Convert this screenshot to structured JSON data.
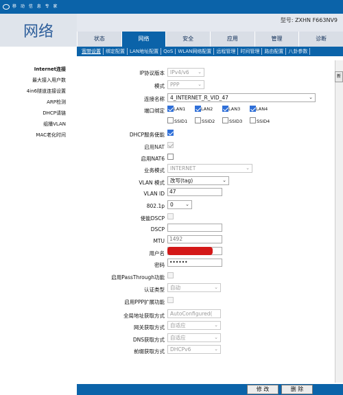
{
  "brand": {
    "slogan": "移 动 信 息 专 家"
  },
  "header": {
    "model_label": "型号:",
    "model_value": "ZXHN F663NV9",
    "section_title": "网络"
  },
  "tabs": [
    "状态",
    "网络",
    "安全",
    "应用",
    "管理",
    "诊断"
  ],
  "active_tab": "网络",
  "subnav": [
    "宽带设置",
    "绑定配置",
    "LAN地址配置",
    "QoS",
    "WLAN网络配置",
    "远程管理",
    "时间管理",
    "路由配置",
    "八卦参数"
  ],
  "sidebar": {
    "items": [
      "Internet连接",
      "最大接入用户数",
      "4in6隧道连接设置",
      "ARP检测",
      "DHCP请链",
      "组播VLAN",
      "MAC老化时间"
    ]
  },
  "form": {
    "ip_version": {
      "label": "IP协议版本",
      "value": "IPv4/v6"
    },
    "mode": {
      "label": "模式",
      "value": "PPP"
    },
    "conn_name": {
      "label": "连接名称",
      "value": "4_INTERNET_R_VID_47"
    },
    "port_binding": {
      "label": "端口绑定",
      "ports": [
        {
          "name": "LAN1",
          "checked": true
        },
        {
          "name": "LAN2",
          "checked": true
        },
        {
          "name": "LAN3",
          "checked": true
        },
        {
          "name": "LAN4",
          "checked": true
        },
        {
          "name": "SSID1",
          "checked": false
        },
        {
          "name": "SSID2",
          "checked": false
        },
        {
          "name": "SSID3",
          "checked": false
        },
        {
          "name": "SSID4",
          "checked": false
        }
      ]
    },
    "dhcp_enable": {
      "label": "DHCP服务使能",
      "checked": true
    },
    "nat": {
      "label": "启用NAT",
      "checked": true
    },
    "nat6": {
      "label": "启用NAT6",
      "checked": false
    },
    "service_mode": {
      "label": "业务模式",
      "value": "INTERNET"
    },
    "vlan_mode": {
      "label": "VLAN 模式",
      "value": "改写(tag)"
    },
    "vlan_id": {
      "label": "VLAN ID",
      "value": "47"
    },
    "dot1p": {
      "label": "802.1p",
      "value": "0"
    },
    "dscp_enable": {
      "label": "使能DSCP",
      "checked": false
    },
    "dscp": {
      "label": "DSCP",
      "value": ""
    },
    "mtu": {
      "label": "MTU",
      "value": "1492"
    },
    "username": {
      "label": "用户名",
      "value": "[redacted]"
    },
    "password": {
      "label": "密码",
      "value": "••••••"
    },
    "passthrough": {
      "label": "启用PassThrough功能",
      "checked": false
    },
    "auth_type": {
      "label": "认证类型",
      "value": "自动"
    },
    "ppp_ext": {
      "label": "启用PPP扩展功能",
      "checked": false
    },
    "global_addr": {
      "label": "全局地址获取方式",
      "value": "AutoConfigured("
    },
    "gateway": {
      "label": "网关获取方式",
      "value": "自适应"
    },
    "dns": {
      "label": "DNS获取方式",
      "value": "自适应"
    },
    "prefix": {
      "label": "前缀获取方式",
      "value": "DHCPv6"
    }
  },
  "buttons": {
    "modify": "修 改",
    "delete": "删 除"
  },
  "right_stub": "新",
  "colors": {
    "primary": "#0b63a9",
    "checkbox": "#2f6fd8",
    "redaction": "#d41818"
  }
}
